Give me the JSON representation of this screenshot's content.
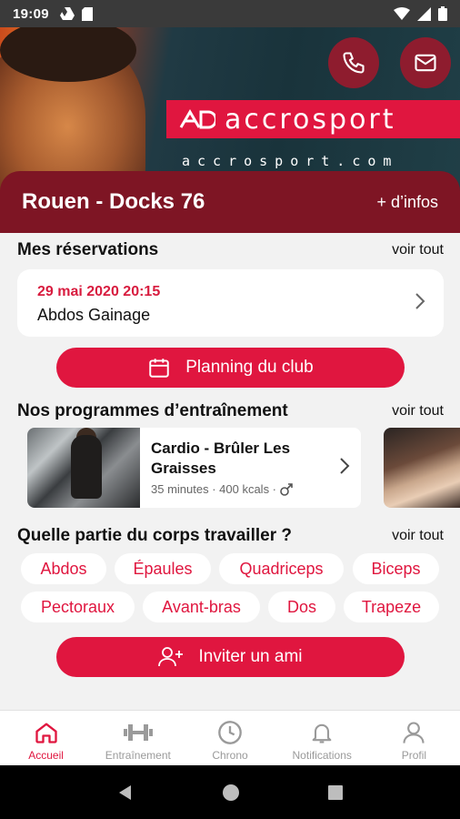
{
  "status_bar": {
    "time": "19:09"
  },
  "hero": {
    "brand_name": "accrosport",
    "brand_url": "accrosport.com",
    "club_name": "Rouen - Docks 76",
    "more_info": "+ d’infos"
  },
  "reservations": {
    "title": "Mes réservations",
    "see_all": "voir tout",
    "item": {
      "date": "29 mai 2020 20:15",
      "name": "Abdos Gainage"
    }
  },
  "planning_button": "Planning du club",
  "programs": {
    "title": "Nos programmes d’entraînement",
    "see_all": "voir tout",
    "item": {
      "title": "Cardio - Brûler Les Graisses",
      "meta": "35 minutes · 400 kcals ·"
    }
  },
  "body_parts": {
    "title": "Quelle partie du corps travailler ?",
    "see_all": "voir tout",
    "chips": [
      "Abdos",
      "Épaules",
      "Quadriceps",
      "Biceps",
      "Pectoraux",
      "Avant-bras",
      "Dos",
      "Trapeze"
    ]
  },
  "invite_button": "Inviter un ami",
  "bottom_nav": {
    "items": [
      {
        "label": "Accueil",
        "icon": "home-icon"
      },
      {
        "label": "Entraînement",
        "icon": "dumbbell-icon"
      },
      {
        "label": "Chrono",
        "icon": "clock-icon"
      },
      {
        "label": "Notifications",
        "icon": "bell-icon"
      },
      {
        "label": "Profil",
        "icon": "user-icon"
      }
    ],
    "active": "Accueil"
  },
  "colors": {
    "accent": "#e0163f",
    "banner": "#7e1524",
    "status_bar": "#3a3a3a"
  }
}
